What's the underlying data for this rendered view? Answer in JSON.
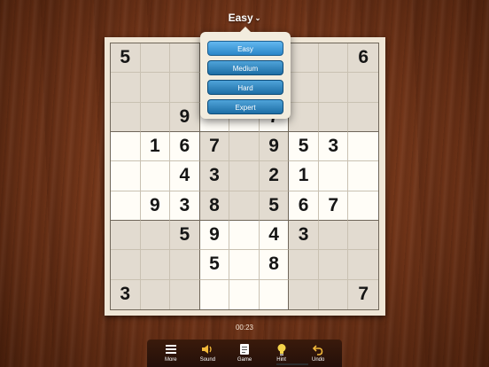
{
  "header": {
    "difficulty_label": "Easy"
  },
  "difficulty_menu": {
    "options": [
      "Easy",
      "Medium",
      "Hard",
      "Expert"
    ],
    "selected": "Easy"
  },
  "board": {
    "rows": [
      [
        "5",
        "",
        "",
        "",
        "",
        "",
        "",
        "",
        "6"
      ],
      [
        "",
        "",
        "",
        "",
        "",
        "",
        "",
        "",
        ""
      ],
      [
        "",
        "",
        "9",
        "",
        "",
        "7",
        "",
        "",
        ""
      ],
      [
        "",
        "1",
        "6",
        "7",
        "",
        "9",
        "5",
        "3",
        ""
      ],
      [
        "",
        "",
        "4",
        "3",
        "",
        "2",
        "1",
        "",
        ""
      ],
      [
        "",
        "9",
        "3",
        "8",
        "",
        "5",
        "6",
        "7",
        ""
      ],
      [
        "",
        "",
        "5",
        "9",
        "",
        "4",
        "3",
        "",
        ""
      ],
      [
        "",
        "",
        "",
        "5",
        "",
        "8",
        "",
        "",
        ""
      ],
      [
        "3",
        "",
        "",
        "",
        "",
        "",
        "",
        "",
        "7"
      ]
    ]
  },
  "timer": "00:23",
  "toolbar": {
    "items": [
      {
        "label": "More",
        "icon": "menu-icon"
      },
      {
        "label": "Sound",
        "icon": "speaker-icon"
      },
      {
        "label": "Game",
        "icon": "game-icon"
      },
      {
        "label": "Hint",
        "icon": "lightbulb-icon"
      },
      {
        "label": "Undo",
        "icon": "undo-icon"
      }
    ]
  },
  "colors": {
    "menu_button": "#2a86c8",
    "board_light": "#fffdf7",
    "board_shade": "#e2dbd0"
  }
}
